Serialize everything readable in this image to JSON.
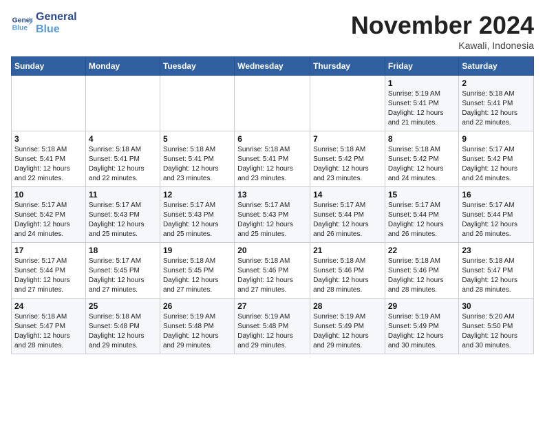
{
  "logo": {
    "line1": "General",
    "line2": "Blue"
  },
  "title": "November 2024",
  "location": "Kawali, Indonesia",
  "days_header": [
    "Sunday",
    "Monday",
    "Tuesday",
    "Wednesday",
    "Thursday",
    "Friday",
    "Saturday"
  ],
  "weeks": [
    [
      {
        "day": "",
        "info": ""
      },
      {
        "day": "",
        "info": ""
      },
      {
        "day": "",
        "info": ""
      },
      {
        "day": "",
        "info": ""
      },
      {
        "day": "",
        "info": ""
      },
      {
        "day": "1",
        "info": "Sunrise: 5:19 AM\nSunset: 5:41 PM\nDaylight: 12 hours\nand 21 minutes."
      },
      {
        "day": "2",
        "info": "Sunrise: 5:18 AM\nSunset: 5:41 PM\nDaylight: 12 hours\nand 22 minutes."
      }
    ],
    [
      {
        "day": "3",
        "info": "Sunrise: 5:18 AM\nSunset: 5:41 PM\nDaylight: 12 hours\nand 22 minutes."
      },
      {
        "day": "4",
        "info": "Sunrise: 5:18 AM\nSunset: 5:41 PM\nDaylight: 12 hours\nand 22 minutes."
      },
      {
        "day": "5",
        "info": "Sunrise: 5:18 AM\nSunset: 5:41 PM\nDaylight: 12 hours\nand 23 minutes."
      },
      {
        "day": "6",
        "info": "Sunrise: 5:18 AM\nSunset: 5:41 PM\nDaylight: 12 hours\nand 23 minutes."
      },
      {
        "day": "7",
        "info": "Sunrise: 5:18 AM\nSunset: 5:42 PM\nDaylight: 12 hours\nand 23 minutes."
      },
      {
        "day": "8",
        "info": "Sunrise: 5:18 AM\nSunset: 5:42 PM\nDaylight: 12 hours\nand 24 minutes."
      },
      {
        "day": "9",
        "info": "Sunrise: 5:17 AM\nSunset: 5:42 PM\nDaylight: 12 hours\nand 24 minutes."
      }
    ],
    [
      {
        "day": "10",
        "info": "Sunrise: 5:17 AM\nSunset: 5:42 PM\nDaylight: 12 hours\nand 24 minutes."
      },
      {
        "day": "11",
        "info": "Sunrise: 5:17 AM\nSunset: 5:43 PM\nDaylight: 12 hours\nand 25 minutes."
      },
      {
        "day": "12",
        "info": "Sunrise: 5:17 AM\nSunset: 5:43 PM\nDaylight: 12 hours\nand 25 minutes."
      },
      {
        "day": "13",
        "info": "Sunrise: 5:17 AM\nSunset: 5:43 PM\nDaylight: 12 hours\nand 25 minutes."
      },
      {
        "day": "14",
        "info": "Sunrise: 5:17 AM\nSunset: 5:44 PM\nDaylight: 12 hours\nand 26 minutes."
      },
      {
        "day": "15",
        "info": "Sunrise: 5:17 AM\nSunset: 5:44 PM\nDaylight: 12 hours\nand 26 minutes."
      },
      {
        "day": "16",
        "info": "Sunrise: 5:17 AM\nSunset: 5:44 PM\nDaylight: 12 hours\nand 26 minutes."
      }
    ],
    [
      {
        "day": "17",
        "info": "Sunrise: 5:17 AM\nSunset: 5:44 PM\nDaylight: 12 hours\nand 27 minutes."
      },
      {
        "day": "18",
        "info": "Sunrise: 5:17 AM\nSunset: 5:45 PM\nDaylight: 12 hours\nand 27 minutes."
      },
      {
        "day": "19",
        "info": "Sunrise: 5:18 AM\nSunset: 5:45 PM\nDaylight: 12 hours\nand 27 minutes."
      },
      {
        "day": "20",
        "info": "Sunrise: 5:18 AM\nSunset: 5:46 PM\nDaylight: 12 hours\nand 27 minutes."
      },
      {
        "day": "21",
        "info": "Sunrise: 5:18 AM\nSunset: 5:46 PM\nDaylight: 12 hours\nand 28 minutes."
      },
      {
        "day": "22",
        "info": "Sunrise: 5:18 AM\nSunset: 5:46 PM\nDaylight: 12 hours\nand 28 minutes."
      },
      {
        "day": "23",
        "info": "Sunrise: 5:18 AM\nSunset: 5:47 PM\nDaylight: 12 hours\nand 28 minutes."
      }
    ],
    [
      {
        "day": "24",
        "info": "Sunrise: 5:18 AM\nSunset: 5:47 PM\nDaylight: 12 hours\nand 28 minutes."
      },
      {
        "day": "25",
        "info": "Sunrise: 5:18 AM\nSunset: 5:48 PM\nDaylight: 12 hours\nand 29 minutes."
      },
      {
        "day": "26",
        "info": "Sunrise: 5:19 AM\nSunset: 5:48 PM\nDaylight: 12 hours\nand 29 minutes."
      },
      {
        "day": "27",
        "info": "Sunrise: 5:19 AM\nSunset: 5:48 PM\nDaylight: 12 hours\nand 29 minutes."
      },
      {
        "day": "28",
        "info": "Sunrise: 5:19 AM\nSunset: 5:49 PM\nDaylight: 12 hours\nand 29 minutes."
      },
      {
        "day": "29",
        "info": "Sunrise: 5:19 AM\nSunset: 5:49 PM\nDaylight: 12 hours\nand 30 minutes."
      },
      {
        "day": "30",
        "info": "Sunrise: 5:20 AM\nSunset: 5:50 PM\nDaylight: 12 hours\nand 30 minutes."
      }
    ]
  ]
}
